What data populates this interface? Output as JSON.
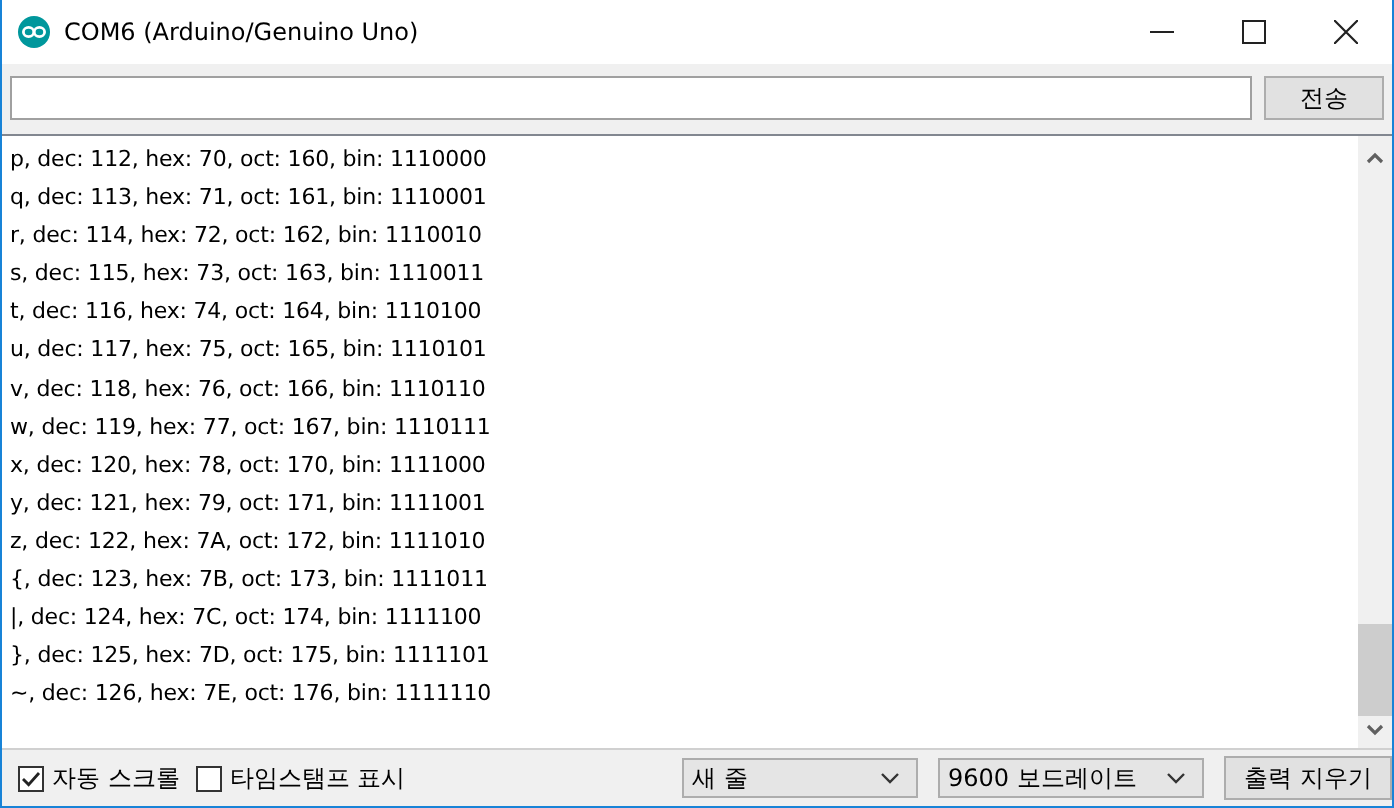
{
  "window": {
    "title": "COM6 (Arduino/Genuino Uno)"
  },
  "send_bar": {
    "button": "전송"
  },
  "output_lines": [
    "p, dec: 112, hex: 70, oct: 160, bin: 1110000",
    "q, dec: 113, hex: 71, oct: 161, bin: 1110001",
    "r, dec: 114, hex: 72, oct: 162, bin: 1110010",
    "s, dec: 115, hex: 73, oct: 163, bin: 1110011",
    "t, dec: 116, hex: 74, oct: 164, bin: 1110100",
    "u, dec: 117, hex: 75, oct: 165, bin: 1110101",
    "v, dec: 118, hex: 76, oct: 166, bin: 1110110",
    "w, dec: 119, hex: 77, oct: 167, bin: 1110111",
    "x, dec: 120, hex: 78, oct: 170, bin: 1111000",
    "y, dec: 121, hex: 79, oct: 171, bin: 1111001",
    "z, dec: 122, hex: 7A, oct: 172, bin: 1111010",
    "{, dec: 123, hex: 7B, oct: 173, bin: 1111011",
    "|, dec: 124, hex: 7C, oct: 174, bin: 1111100",
    "}, dec: 125, hex: 7D, oct: 175, bin: 1111101",
    "~, dec: 126, hex: 7E, oct: 176, bin: 1111110"
  ],
  "status_bar": {
    "checkboxes": [
      {
        "label": "자동 스크롤",
        "checked": true
      },
      {
        "label": "타임스탬프 표시",
        "checked": false
      }
    ],
    "line_ending": "새 줄",
    "baud_rate": "9600 보드레이트",
    "clear_button": "출력 지우기"
  }
}
